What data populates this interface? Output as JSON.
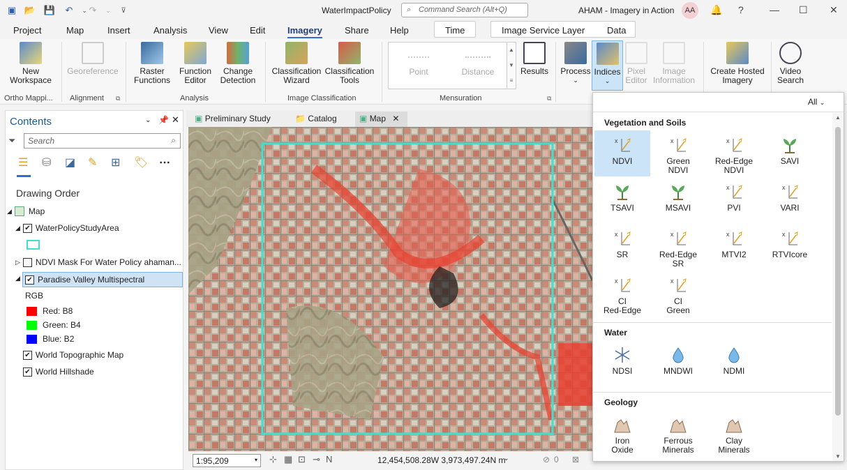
{
  "window": {
    "title": "WaterImpactPolicy",
    "command_search_placeholder": "Command Search (Alt+Q)",
    "project_name": "AHAM - Imagery in Action",
    "avatar_initials": "AA"
  },
  "menu": {
    "tabs": [
      "Project",
      "Map",
      "Insert",
      "Analysis",
      "View",
      "Edit",
      "Imagery",
      "Share",
      "Help"
    ],
    "active": "Imagery",
    "context_tabs": [
      "Time",
      "Image Service Layer",
      "Data"
    ]
  },
  "ribbon": {
    "new_workspace": "New\nWorkspace",
    "georeference": "Georeference",
    "ortho_label": "Ortho Mappi...",
    "alignment_label": "Alignment",
    "raster_functions": "Raster\nFunctions",
    "function_editor": "Function\nEditor",
    "change_detection": "Change\nDetection",
    "analysis_label": "Analysis",
    "classification_wizard": "Classification\nWizard",
    "classification_tools": "Classification\nTools",
    "image_classification_label": "Image Classification",
    "point": "Point",
    "distance": "Distance",
    "results": "Results",
    "mensuration_label": "Mensuration",
    "process": "Process",
    "indices": "Indices",
    "pixel_editor": "Pixel\nEditor",
    "image_information": "Image\nInformation",
    "create_hosted": "Create Hosted\nImagery",
    "video_search": "Video\nSearch"
  },
  "contents": {
    "title": "Contents",
    "search_placeholder": "Search",
    "drawing_order": "Drawing Order",
    "map_label": "Map",
    "layers": [
      {
        "name": "WaterPolicyStudyArea",
        "checked": true
      },
      {
        "name": "NDVI Mask For Water Policy ahaman...",
        "checked": false
      },
      {
        "name": "Paradise Valley Multispectral",
        "checked": true,
        "selected": true
      },
      {
        "name": "World Topographic Map",
        "checked": true
      },
      {
        "name": "World Hillshade",
        "checked": true
      }
    ],
    "rgb_label": "RGB",
    "bands": [
      {
        "label": "Red:  B8",
        "color": "#ff0000"
      },
      {
        "label": "Green:  B4",
        "color": "#00ff00"
      },
      {
        "label": "Blue:  B2",
        "color": "#0000ff"
      }
    ],
    "study_area_color": "#40e0d0"
  },
  "views": {
    "tabs": [
      "Preliminary Study",
      "Catalog",
      "Map"
    ],
    "active": "Map"
  },
  "status": {
    "scale": "1:95,209",
    "coordinates": "12,454,508.28W 3,973,497.24N m",
    "selection_count": "0"
  },
  "indices_gallery": {
    "filter": "All",
    "categories": [
      {
        "name": "Vegetation and Soils",
        "items": [
          {
            "label": "NDVI",
            "icon": "index-axis-icon",
            "selected": true
          },
          {
            "label": "Green\nNDVI",
            "icon": "index-axis-icon"
          },
          {
            "label": "Red-Edge\nNDVI",
            "icon": "index-axis-icon"
          },
          {
            "label": "SAVI",
            "icon": "plant-icon"
          },
          {
            "label": "TSAVI",
            "icon": "plant-icon"
          },
          {
            "label": "MSAVI",
            "icon": "plant-icon"
          },
          {
            "label": "PVI",
            "icon": "index-axis-icon"
          },
          {
            "label": "VARI",
            "icon": "index-axis-icon"
          },
          {
            "label": "SR",
            "icon": "index-axis-icon"
          },
          {
            "label": "Red-Edge\nSR",
            "icon": "index-axis-icon"
          },
          {
            "label": "MTVI2",
            "icon": "index-axis-icon"
          },
          {
            "label": "RTVIcore",
            "icon": "index-axis-icon"
          },
          {
            "label": "CI\nRed-Edge",
            "icon": "index-axis-icon"
          },
          {
            "label": "CI\nGreen",
            "icon": "index-axis-icon"
          }
        ]
      },
      {
        "name": "Water",
        "items": [
          {
            "label": "NDSI",
            "icon": "snowflake-icon"
          },
          {
            "label": "MNDWI",
            "icon": "water-drop-icon"
          },
          {
            "label": "NDMI",
            "icon": "water-drop-icon"
          }
        ]
      },
      {
        "name": "Geology",
        "items": [
          {
            "label": "Iron\nOxide",
            "icon": "rock-icon"
          },
          {
            "label": "Ferrous\nMinerals",
            "icon": "rock-icon"
          },
          {
            "label": "Clay\nMinerals",
            "icon": "rock-icon"
          }
        ]
      }
    ]
  }
}
